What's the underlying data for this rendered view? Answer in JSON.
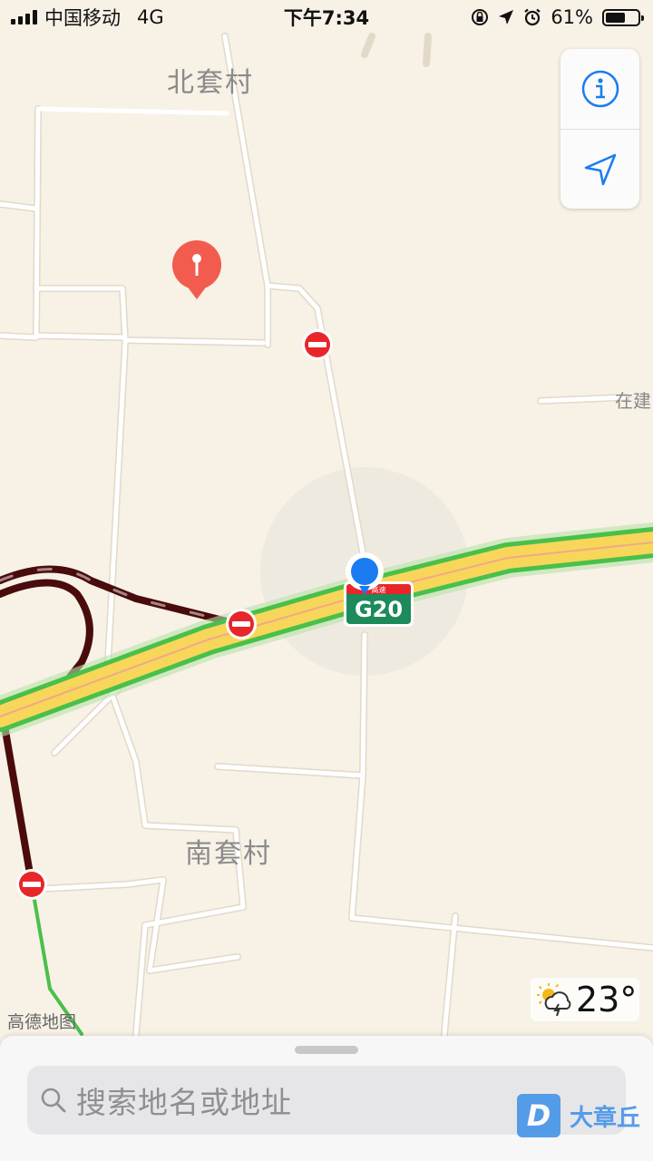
{
  "status": {
    "carrier": "中国移动",
    "network": "4G",
    "time": "下午7:34",
    "battery_percent": 61,
    "battery_label": "61%"
  },
  "map": {
    "places": {
      "north_village": "北套村",
      "south_village": "南套村"
    },
    "road_label_right": "在建",
    "highway_shield": {
      "top_text": "高速",
      "number": "G20"
    },
    "brand": "高德地图"
  },
  "controls": {
    "info_icon": "info-icon",
    "locate_icon": "location-arrow-icon"
  },
  "weather": {
    "icon": "sun-storm-icon",
    "temperature": "23°"
  },
  "search": {
    "placeholder": "搜索地名或地址"
  },
  "watermark": {
    "logo_letter": "D",
    "text": "大章丘"
  },
  "colors": {
    "map_bg": "#f7f1e6",
    "road": "#ffffff",
    "highway_fill": "#f7d65a",
    "highway_edge": "#49c04a",
    "congested": "#4a0b0b",
    "no_entry": "#e8262a",
    "user_dot": "#1a7cf0",
    "pin": "#f25c4e",
    "accent_blue": "#1a7cf0",
    "shield_green": "#1c8a5a"
  }
}
